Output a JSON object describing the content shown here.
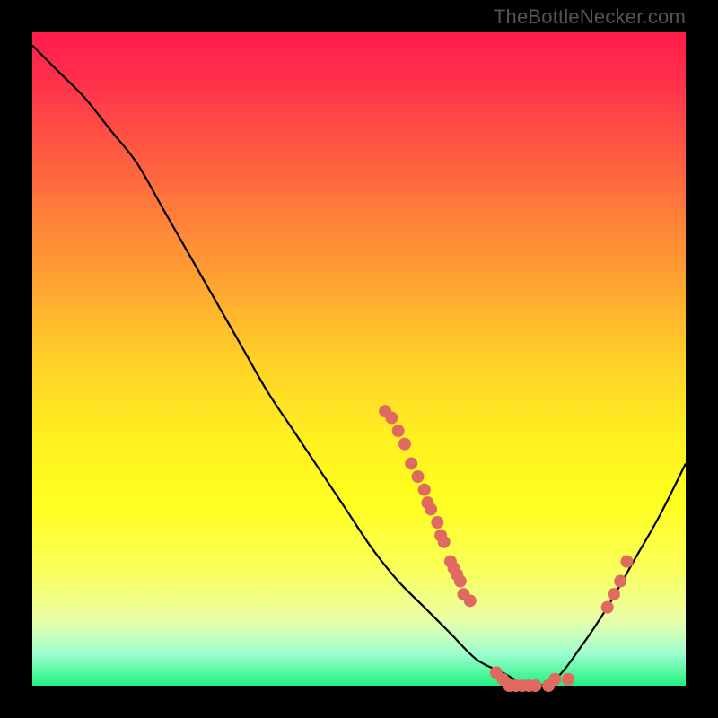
{
  "watermark": "TheBottleNecker.com",
  "chart_data": {
    "type": "line",
    "title": "",
    "xlabel": "",
    "ylabel": "",
    "xlim": [
      0,
      100
    ],
    "ylim": [
      0,
      100
    ],
    "series": [
      {
        "name": "bottleneck-curve",
        "x": [
          0,
          4,
          8,
          12,
          16,
          20,
          24,
          28,
          32,
          36,
          40,
          44,
          48,
          52,
          56,
          60,
          64,
          68,
          72,
          76,
          80,
          84,
          88,
          92,
          96,
          100
        ],
        "y": [
          98,
          94,
          90,
          85,
          80,
          73,
          66,
          59,
          52,
          45,
          39,
          33,
          27,
          21,
          16,
          12,
          8,
          4,
          2,
          0,
          1,
          6,
          12,
          19,
          26,
          34
        ]
      }
    ],
    "highlight_clusters": [
      {
        "name": "left-cluster",
        "points": [
          {
            "x": 54,
            "y": 42
          },
          {
            "x": 55,
            "y": 41
          },
          {
            "x": 56,
            "y": 39
          },
          {
            "x": 57,
            "y": 37
          },
          {
            "x": 58,
            "y": 34
          },
          {
            "x": 59,
            "y": 32
          },
          {
            "x": 60,
            "y": 30
          },
          {
            "x": 60.5,
            "y": 28
          },
          {
            "x": 61,
            "y": 27
          },
          {
            "x": 62,
            "y": 25
          },
          {
            "x": 62.5,
            "y": 23
          },
          {
            "x": 63,
            "y": 22
          },
          {
            "x": 64,
            "y": 19
          },
          {
            "x": 64.5,
            "y": 18
          },
          {
            "x": 65,
            "y": 17
          },
          {
            "x": 65.5,
            "y": 16
          },
          {
            "x": 66,
            "y": 14
          },
          {
            "x": 67,
            "y": 13
          }
        ]
      },
      {
        "name": "valley-cluster",
        "points": [
          {
            "x": 71,
            "y": 2
          },
          {
            "x": 72,
            "y": 1
          },
          {
            "x": 73,
            "y": 0
          },
          {
            "x": 74,
            "y": 0
          },
          {
            "x": 75,
            "y": 0
          },
          {
            "x": 76,
            "y": 0
          },
          {
            "x": 77,
            "y": 0
          },
          {
            "x": 79,
            "y": 0
          },
          {
            "x": 80,
            "y": 1
          },
          {
            "x": 82,
            "y": 1
          }
        ]
      },
      {
        "name": "right-cluster",
        "points": [
          {
            "x": 88,
            "y": 12
          },
          {
            "x": 89,
            "y": 14
          },
          {
            "x": 90,
            "y": 16
          },
          {
            "x": 91,
            "y": 19
          }
        ]
      }
    ],
    "gradient_stops": [
      {
        "pos": 0,
        "color": "#ff1a4a"
      },
      {
        "pos": 50,
        "color": "#ffd028"
      },
      {
        "pos": 80,
        "color": "#ffff20"
      },
      {
        "pos": 100,
        "color": "#20f080"
      }
    ]
  }
}
